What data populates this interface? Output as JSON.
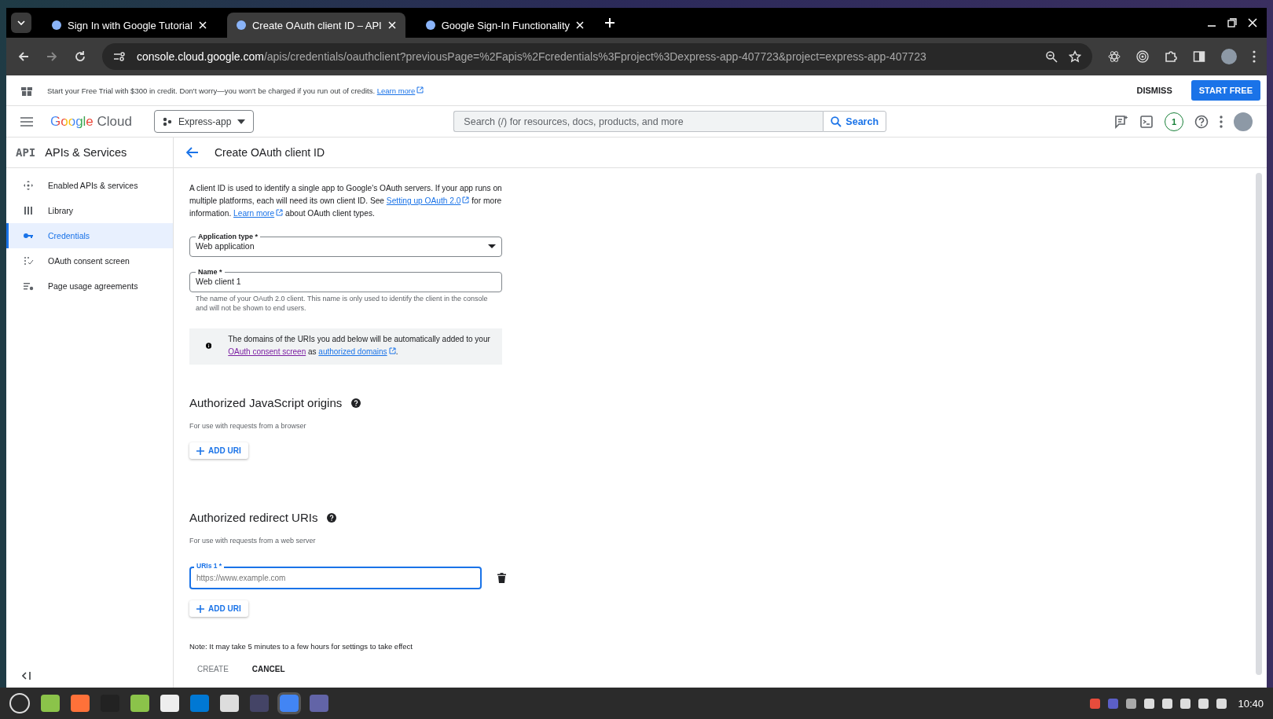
{
  "browser": {
    "tabs": [
      {
        "title": "Sign In with Google Tutorial",
        "selected": false
      },
      {
        "title": "Create OAuth client ID – API",
        "selected": true
      },
      {
        "title": "Google Sign-In Functionality",
        "selected": false
      }
    ],
    "url_host": "console.cloud.google.com",
    "url_path": "/apis/credentials/oauthclient?previousPage=%2Fapis%2Fcredentials%3Fproject%3Dexpress-app-407723&project=express-app-407723"
  },
  "banner": {
    "text": "Start your Free Trial with $300 in credit. Don't worry—you won't be charged if you run out of credits.",
    "link": "Learn more",
    "dismiss": "DISMISS",
    "start": "START FREE"
  },
  "header": {
    "logo_brand": "Google",
    "logo_product": "Cloud",
    "project": "Express-app",
    "search_placeholder": "Search (/) for resources, docs, products, and more",
    "search_button": "Search",
    "notifications": "1"
  },
  "sidebar": {
    "badge": "API",
    "title": "APIs & Services",
    "items": [
      {
        "label": "Enabled APIs & services",
        "selected": false
      },
      {
        "label": "Library",
        "selected": false
      },
      {
        "label": "Credentials",
        "selected": true
      },
      {
        "label": "OAuth consent screen",
        "selected": false
      },
      {
        "label": "Page usage agreements",
        "selected": false
      }
    ]
  },
  "page": {
    "title": "Create OAuth client ID",
    "intro": [
      {
        "kind": "text",
        "text": "A client ID is used to identify a single app to Google's OAuth servers. If your app runs on multiple platforms, each will need its own client ID. See "
      },
      {
        "kind": "link",
        "text": "Setting up OAuth 2.0"
      },
      {
        "kind": "text",
        "text": " for more information. "
      },
      {
        "kind": "link",
        "text": "Learn more"
      },
      {
        "kind": "text",
        "text": " about OAuth client types."
      }
    ],
    "application_type": {
      "label": "Application type *",
      "value": "Web application"
    },
    "name": {
      "label": "Name *",
      "value": "Web client 1",
      "hint": "The name of your OAuth 2.0 client. This name is only used to identify the client in the console and will not be shown to end users."
    },
    "info": [
      {
        "kind": "text",
        "text": "The domains of the URIs you add below will be automatically added to your "
      },
      {
        "kind": "visited",
        "text": "OAuth consent screen"
      },
      {
        "kind": "text",
        "text": " as "
      },
      {
        "kind": "link",
        "text": "authorized domains"
      },
      {
        "kind": "text",
        "text": "."
      }
    ],
    "sections": [
      {
        "title": "Authorized JavaScript origins",
        "subtitle": "For use with requests from a browser",
        "add": "ADD URI"
      },
      {
        "title": "Authorized redirect URIs",
        "subtitle": "For use with requests from a web server",
        "uris": [
          {
            "label": "URIs 1 *",
            "placeholder": "https://www.example.com",
            "focused": true
          }
        ],
        "add": "ADD URI"
      }
    ],
    "note": "Note: It may take 5 minutes to a few hours for settings to take effect",
    "create": {
      "label": "CREATE",
      "disabled": true
    },
    "cancel": "CANCEL"
  },
  "taskbar": {
    "clock": "10:40"
  }
}
